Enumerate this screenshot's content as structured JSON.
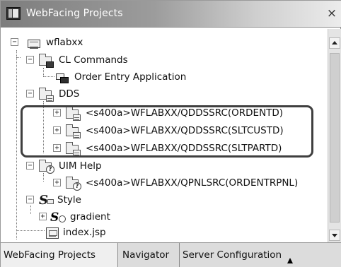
{
  "window": {
    "title": "WebFacing Projects",
    "close_glyph": "×"
  },
  "tree": {
    "root": {
      "label": "wflabxx",
      "expander": "−",
      "icon": "project-icon"
    },
    "cl_commands": {
      "label": "CL Commands",
      "expander": "−",
      "icon": "folder-icon"
    },
    "order_entry": {
      "label": "Order Entry Application",
      "icon": "application-icon"
    },
    "dds": {
      "label": "DDS",
      "expander": "−",
      "icon": "folder-icon"
    },
    "dds_items": [
      {
        "label": "<s400a>WFLABXX/QDDSSRC(ORDENTD)",
        "expander": "+",
        "icon": "folder-icon"
      },
      {
        "label": "<s400a>WFLABXX/QDDSSRC(SLTCUSTD)",
        "expander": "+",
        "icon": "folder-icon"
      },
      {
        "label": "<s400a>WFLABXX/QDDSSRC(SLTPARTD)",
        "expander": "+",
        "icon": "folder-icon"
      }
    ],
    "uim_help": {
      "label": "UIM Help",
      "expander": "−",
      "icon": "help-folder-icon"
    },
    "uim_item": {
      "label": "<s400a>WFLABXX/QPNLSRC(ORDENTRPNL)",
      "expander": "+",
      "icon": "help-folder-icon"
    },
    "style": {
      "label": "Style",
      "expander": "−",
      "icon": "style-icon"
    },
    "gradient": {
      "label": "gradient",
      "expander": "+",
      "icon": "gradient-icon"
    },
    "index_jsp": {
      "label": "index.jsp",
      "icon": "jsp-file-icon"
    }
  },
  "tabs": [
    {
      "label": "WebFacing Projects",
      "active": true
    },
    {
      "label": "Navigator",
      "active": false
    },
    {
      "label": "Server Configuration",
      "active": false
    }
  ],
  "colors": {
    "title_gradient_start": "#7d7d7d",
    "title_gradient_end": "#ececec",
    "highlight_border": "#3f3f3f"
  }
}
